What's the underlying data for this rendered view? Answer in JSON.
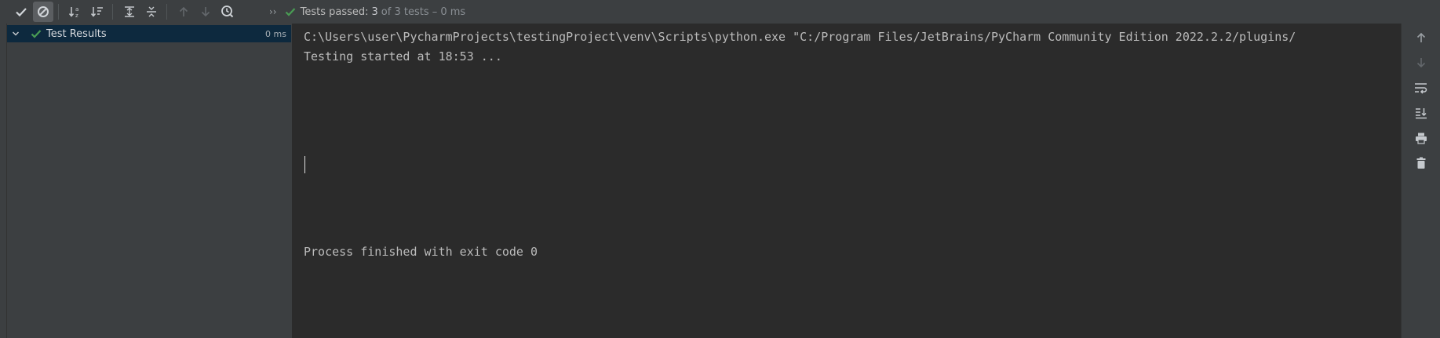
{
  "toolbar": {
    "buttons": [
      {
        "name": "show-passed-icon"
      },
      {
        "name": "show-ignored-icon"
      },
      {
        "name": "sort-alphabetically-icon"
      },
      {
        "name": "sort-by-duration-icon"
      },
      {
        "name": "expand-all-icon"
      },
      {
        "name": "collapse-all-icon"
      },
      {
        "name": "previous-failed-icon"
      },
      {
        "name": "next-failed-icon"
      },
      {
        "name": "test-history-icon"
      }
    ],
    "more": "››",
    "status": {
      "passed_label": "Tests passed:",
      "count": "3",
      "rest": "of 3 tests – 0 ms"
    }
  },
  "tree": {
    "root_label": "Test Results",
    "root_time": "0 ms"
  },
  "console": {
    "lines": [
      "C:\\Users\\user\\PycharmProjects\\testingProject\\venv\\Scripts\\python.exe \"C:/Program Files/JetBrains/PyCharm Community Edition 2022.2.2/plugins/",
      "Testing started at 18:53 ...",
      "Process finished with exit code 0"
    ]
  },
  "colors": {
    "check_green": "#499c54",
    "selection": "#0d293e",
    "console_bg": "#2b2b2b",
    "panel_bg": "#3c3f41"
  }
}
